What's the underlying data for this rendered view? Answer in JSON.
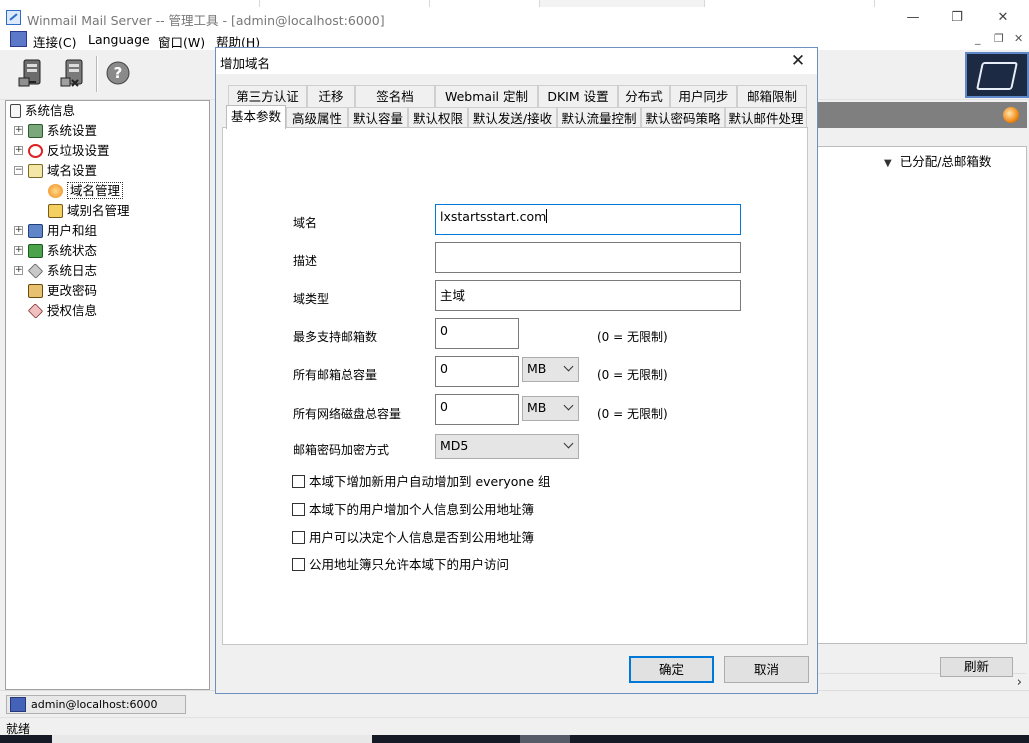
{
  "app": {
    "title": "Winmail Mail Server -- 管理工具 - [admin@localhost:6000]",
    "controls": {
      "minimize": "—",
      "restore": "❐",
      "close": "✕"
    },
    "mdi_controls": {
      "minimize": "_",
      "restore": "❐",
      "close": "✕"
    }
  },
  "menubar": {
    "items": [
      {
        "label": "连接(C)"
      },
      {
        "label": "Language"
      },
      {
        "label": "窗口(W)"
      },
      {
        "label": "帮助(H)"
      }
    ]
  },
  "toolbar": {
    "help_glyph": "?"
  },
  "tree": {
    "items": [
      {
        "label": "系统信息"
      },
      {
        "label": "系统设置"
      },
      {
        "label": "反垃圾设置"
      },
      {
        "label": "域名设置"
      },
      {
        "label": "域名管理"
      },
      {
        "label": "域别名管理"
      },
      {
        "label": "用户和组"
      },
      {
        "label": "系统状态"
      },
      {
        "label": "系统日志"
      },
      {
        "label": "更改密码"
      },
      {
        "label": "授权信息"
      }
    ],
    "expander_plus": "+",
    "expander_minus": "−"
  },
  "right_panel": {
    "column_header": "已分配/总邮箱数",
    "sort_glyph": "▼",
    "scroll_glyph": "›",
    "refresh_label": "刷新"
  },
  "status": {
    "connection": "admin@localhost:6000",
    "ready": "就绪"
  },
  "dialog": {
    "title": "增加域名",
    "close_glyph": "✕",
    "tabs_row1": [
      "第三方认证",
      "迁移",
      "签名档",
      "Webmail 定制",
      "DKIM 设置",
      "分布式",
      "用户同步",
      "邮箱限制"
    ],
    "tabs_row2": [
      "基本参数",
      "高级属性",
      "默认容量",
      "默认权限",
      "默认发送/接收",
      "默认流量控制",
      "默认密码策略",
      "默认邮件处理"
    ],
    "form": {
      "domain_label": "域名",
      "domain_value": "lxstartsstart.com",
      "desc_label": "描述",
      "desc_value": "",
      "type_label": "域类型",
      "type_value": "主域",
      "max_mailbox_label": "最多支持邮箱数",
      "max_mailbox_value": "0",
      "total_mail_label": "所有邮箱总容量",
      "total_mail_value": "0",
      "total_mail_unit": "MB",
      "total_disk_label": "所有网络磁盘总容量",
      "total_disk_value": "0",
      "total_disk_unit": "MB",
      "unlimited_hint": "(0 = 无限制)",
      "encrypt_label": "邮箱密码加密方式",
      "encrypt_value": "MD5"
    },
    "checkboxes": [
      "本域下增加新用户自动增加到 everyone 组",
      "本域下的用户增加个人信息到公用地址簿",
      "用户可以决定个人信息是否到公用地址簿",
      "公用地址簿只允许本域下的用户访问"
    ],
    "ok_label": "确定",
    "cancel_label": "取消"
  },
  "colors": {
    "accent": "#0078d7",
    "window_bg": "#f0f0f0",
    "panel_header": "#7f7f7f",
    "taskbar": "#161a26"
  }
}
